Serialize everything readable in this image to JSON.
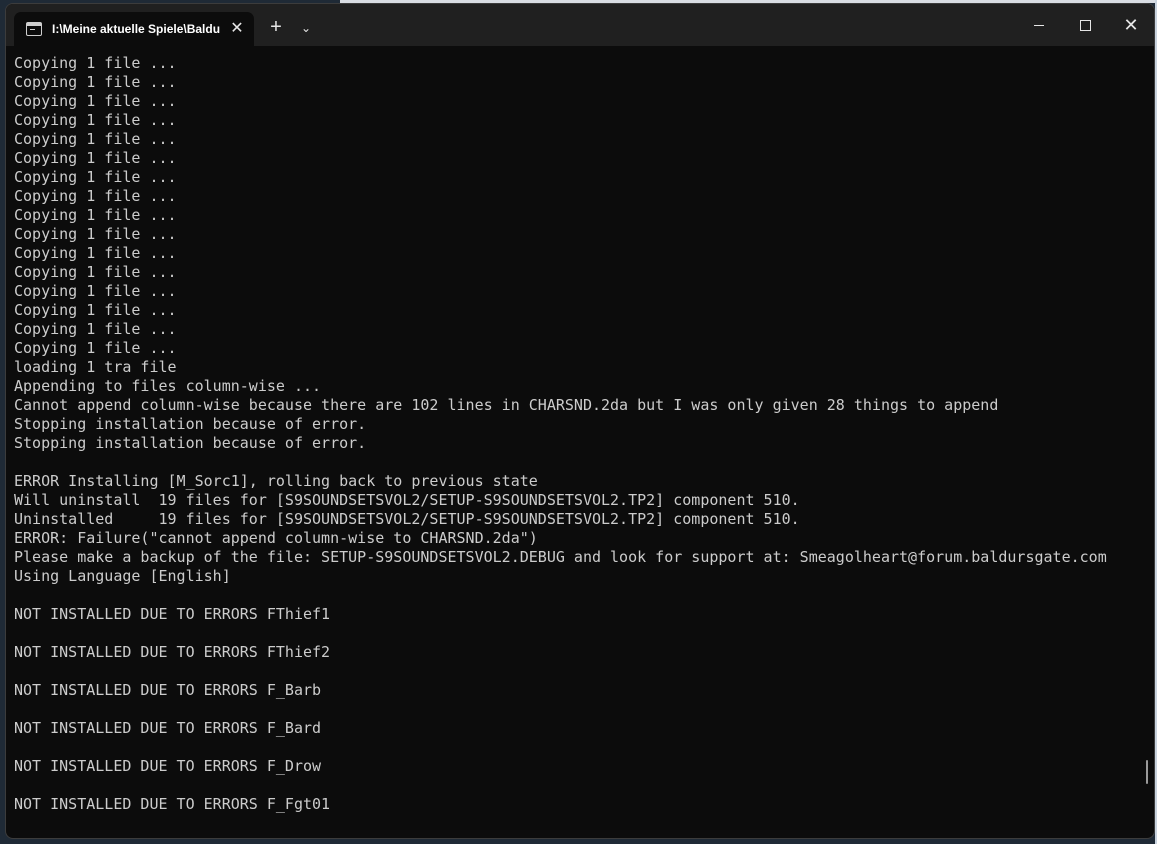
{
  "window": {
    "tab_title": "I:\\Meine aktuelle Spiele\\Baldu",
    "tab_close": "✕",
    "new_tab": "+",
    "tab_dropdown": "⌄",
    "minimize_icon": "minimize-icon",
    "maximize_icon": "maximize-icon",
    "close_icon": "close-icon",
    "close_glyph": "✕"
  },
  "terminal": {
    "lines": [
      "Copying 1 file ...",
      "Copying 1 file ...",
      "Copying 1 file ...",
      "Copying 1 file ...",
      "Copying 1 file ...",
      "Copying 1 file ...",
      "Copying 1 file ...",
      "Copying 1 file ...",
      "Copying 1 file ...",
      "Copying 1 file ...",
      "Copying 1 file ...",
      "Copying 1 file ...",
      "Copying 1 file ...",
      "Copying 1 file ...",
      "Copying 1 file ...",
      "Copying 1 file ...",
      "loading 1 tra file",
      "Appending to files column-wise ...",
      "Cannot append column-wise because there are 102 lines in CHARSND.2da but I was only given 28 things to append",
      "Stopping installation because of error.",
      "Stopping installation because of error.",
      "",
      "ERROR Installing [M_Sorc1], rolling back to previous state",
      "Will uninstall  19 files for [S9SOUNDSETSVOL2/SETUP-S9SOUNDSETSVOL2.TP2] component 510.",
      "Uninstalled     19 files for [S9SOUNDSETSVOL2/SETUP-S9SOUNDSETSVOL2.TP2] component 510.",
      "ERROR: Failure(\"cannot append column-wise to CHARSND.2da\")",
      "Please make a backup of the file: SETUP-S9SOUNDSETSVOL2.DEBUG and look for support at: Smeagolheart@forum.baldursgate.com",
      "Using Language [English]",
      "",
      "NOT INSTALLED DUE TO ERRORS FThief1",
      "",
      "NOT INSTALLED DUE TO ERRORS FThief2",
      "",
      "NOT INSTALLED DUE TO ERRORS F_Barb",
      "",
      "NOT INSTALLED DUE TO ERRORS F_Bard",
      "",
      "NOT INSTALLED DUE TO ERRORS F_Drow",
      "",
      "NOT INSTALLED DUE TO ERRORS F_Fgt01"
    ]
  },
  "colors": {
    "terminal_bg": "#0c0c0c",
    "terminal_fg": "#cccccc",
    "titlebar_bg": "#202020"
  }
}
